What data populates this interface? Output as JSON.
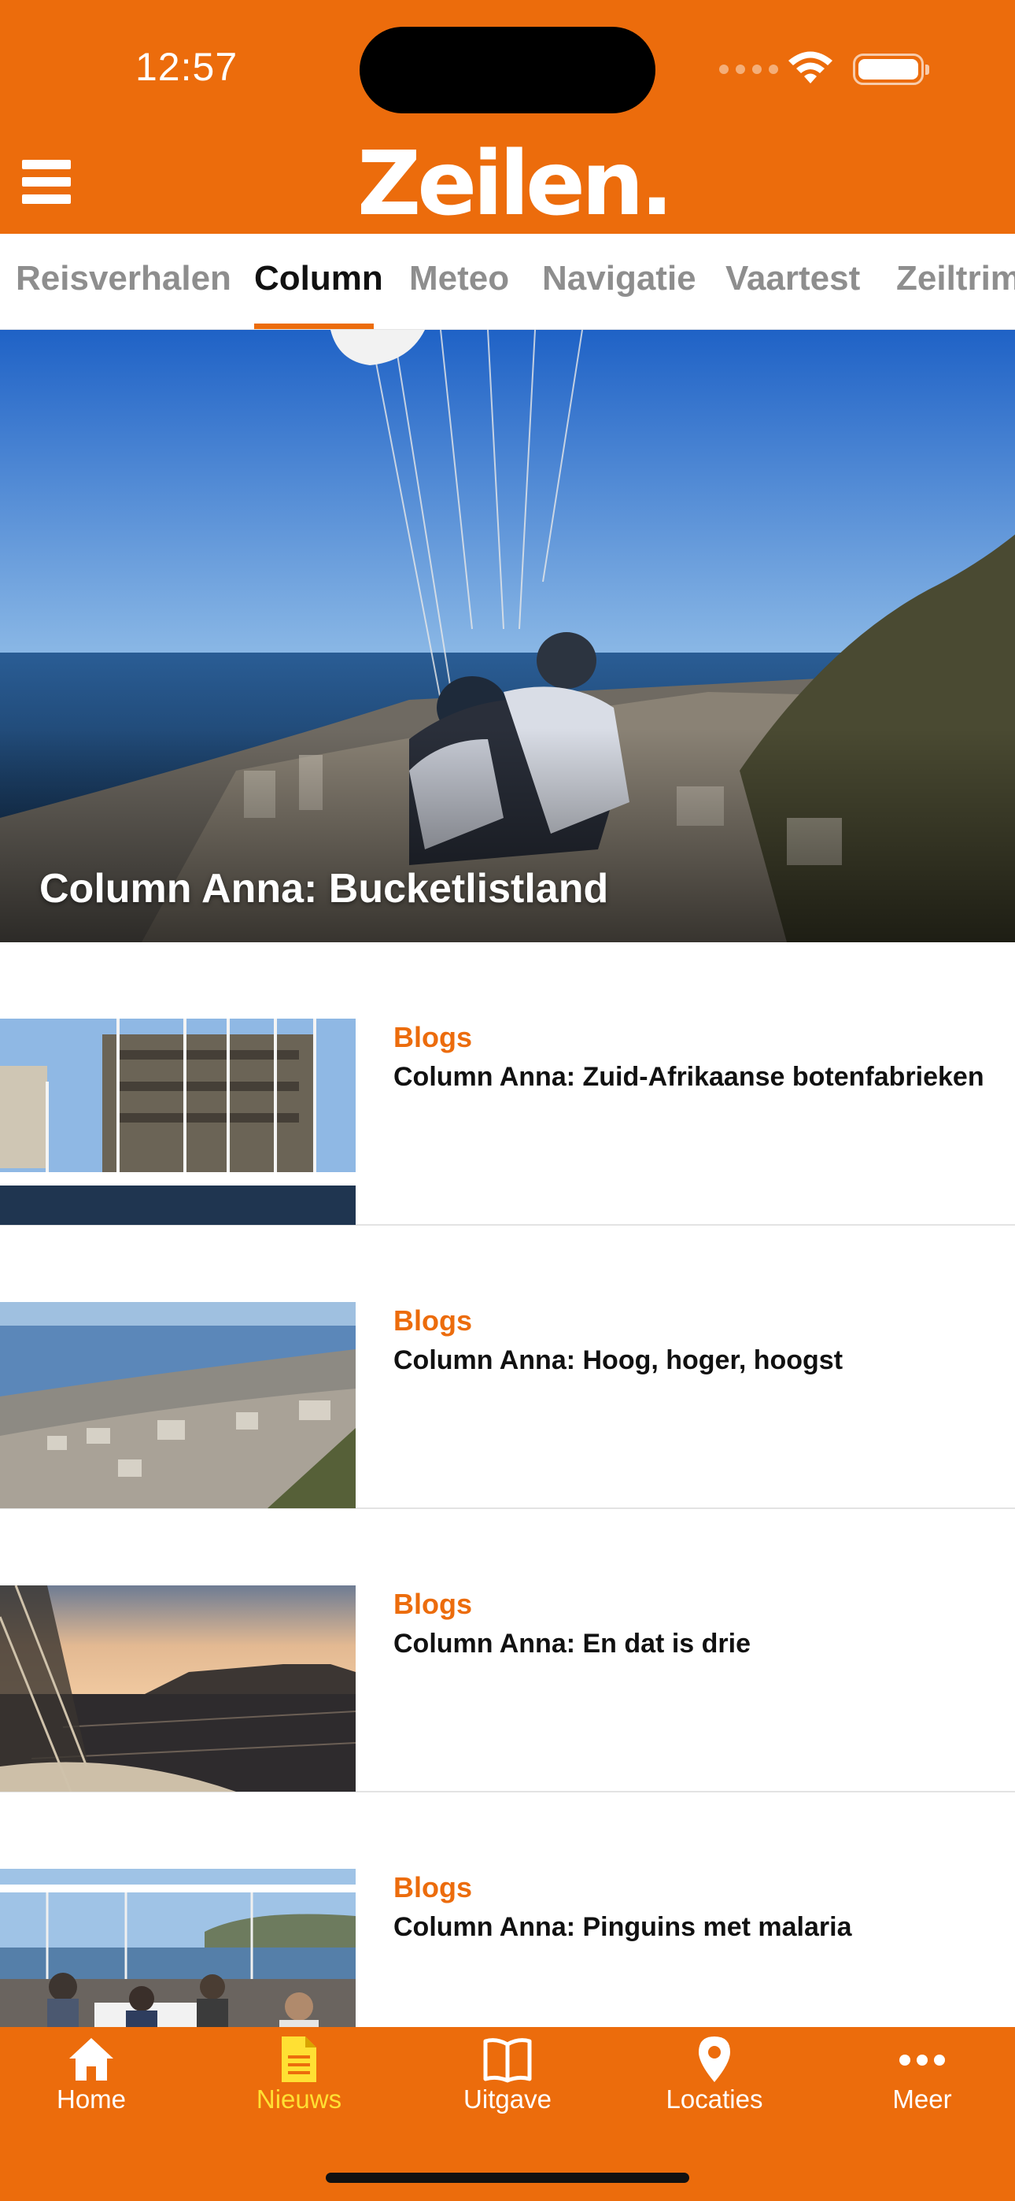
{
  "status_bar": {
    "time": "12:57"
  },
  "header": {
    "logo": "Zeilen."
  },
  "tabs": [
    {
      "label": "Reisverhalen",
      "active": false
    },
    {
      "label": "Column",
      "active": true
    },
    {
      "label": "Meteo",
      "active": false
    },
    {
      "label": "Navigatie",
      "active": false
    },
    {
      "label": "Vaartest",
      "active": false
    },
    {
      "label": "Zeiltrim",
      "active": false
    }
  ],
  "hero": {
    "title": "Column Anna: Bucketlistland"
  },
  "articles": [
    {
      "category": "Blogs",
      "title": "Column Anna: Zuid-Afrikaanse botenfabrieken"
    },
    {
      "category": "Blogs",
      "title": "Column Anna: Hoog, hoger, hoogst"
    },
    {
      "category": "Blogs",
      "title": "Column Anna: En dat is drie"
    },
    {
      "category": "Blogs",
      "title": "Column Anna: Pinguins met malaria"
    }
  ],
  "tabbar": [
    {
      "label": "Home",
      "icon": "home-icon",
      "active": false
    },
    {
      "label": "Nieuws",
      "icon": "news-icon",
      "active": true
    },
    {
      "label": "Uitgave",
      "icon": "book-icon",
      "active": false
    },
    {
      "label": "Locaties",
      "icon": "location-pin-icon",
      "active": false
    },
    {
      "label": "Meer",
      "icon": "more-icon",
      "active": false
    }
  ],
  "colors": {
    "brand": "#EC6C0C",
    "active_tab_icon": "#FFE033"
  }
}
